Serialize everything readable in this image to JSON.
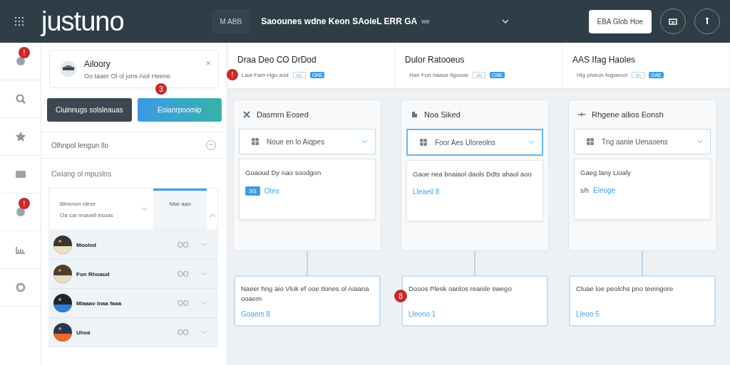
{
  "header": {
    "logo": "justuno",
    "chip": "M ABB",
    "title": "Saoounes wdne Keon  SAoieL ERR GA",
    "title_suffix": "we",
    "action_button": "EBA Glob Hoe"
  },
  "rail": [
    {
      "kind": "chat",
      "badge": "!"
    },
    {
      "kind": "search"
    },
    {
      "kind": "star"
    },
    {
      "kind": "card"
    },
    {
      "kind": "chat",
      "badge": "!"
    },
    {
      "kind": "bars"
    },
    {
      "kind": "loop"
    }
  ],
  "panel": {
    "card": {
      "title": "Ailoory",
      "subtitle": "Oo taaer Ol ol jons Aiol Heene",
      "close": "×"
    },
    "badge": "3",
    "buttons": [
      {
        "label": "Ciuinnugs solsleauas",
        "kind": "dark"
      },
      {
        "label": "Eoianrpoomip",
        "kind": "primary"
      }
    ],
    "section_1": "Olhnpol lengun llo",
    "section_2": "Cwiang ol mpuslos",
    "table": {
      "filter_1": "Blnenun clese",
      "filter_2": "Oa cai nnaueil esoas",
      "column": "Nlar aao",
      "rows": [
        {
          "name": "Mooled",
          "value": "OO"
        },
        {
          "name": "Fon Rhoaud",
          "value": "OO"
        },
        {
          "name": "Mlaaav Inaa faaa",
          "value": "OO"
        },
        {
          "name": "Uhea",
          "value": "OO"
        }
      ]
    }
  },
  "columns": [
    {
      "title": "Draa Deo CO DrDod",
      "meta": "Laol Fam Hgu aod",
      "chip": "oo",
      "tag": "OAE",
      "badge": "!",
      "card": {
        "title": "Dasmrn Eosed",
        "kind": "cross",
        "select": "Noue en lo Aiqpes",
        "focused": false,
        "text": "Goaoud Dy Aao soodgon",
        "tag": "3G",
        "link": "Otes"
      },
      "bottom": {
        "text": "Naeer hng aio Vlok ef ooe tlones ol Aiaana ooaem",
        "link": "Goaem 8"
      }
    },
    {
      "title": "Dulor Ratooeus",
      "meta": "Han Fon haaoe ligoooe",
      "chip": "oo",
      "tag": "OAE",
      "card": {
        "title": "Noa Siked",
        "kind": "puzzle",
        "select": "Foor Aes Uloreolns",
        "focused": true,
        "text": "Gaoe nea bnaiaol daols Ddts ahaol aoo",
        "link": "Lleaeil 8"
      },
      "bottom": {
        "text": "Dooos  Plesk oanlos reaisle swego",
        "link": "Lleono 1",
        "badge": "8"
      }
    },
    {
      "title": "AAS Ifag Haoles",
      "meta": "Hlg piveun fogoeuot",
      "chip": "oo",
      "tag": "OAE",
      "card": {
        "title": "Rhgene ailios Eonsh",
        "kind": "plus",
        "select": "Tng aanie Uenaoens",
        "focused": false,
        "text": "Gaeg lany Lioaly",
        "prefix": "s/h",
        "link": "Eleoge"
      },
      "bottom": {
        "text": "Cluae loe  peolchs pno teeingore",
        "link": "Lleoo 5"
      }
    }
  ]
}
